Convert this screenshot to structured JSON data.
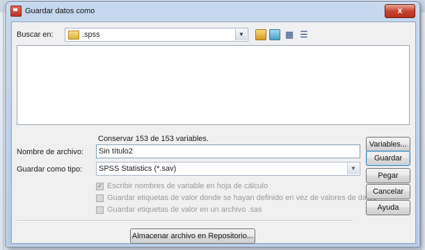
{
  "window": {
    "title": "Guardar datos como",
    "close_label": "x"
  },
  "lookin": {
    "label": "Buscar en:",
    "folder": ".spss"
  },
  "info": {
    "keep_variables": "Conservar 153 de 153 variables."
  },
  "form": {
    "file_name_label": "Nombre de archivo:",
    "file_name_value": "Sin título2",
    "save_type_label": "Guardar como tipo:",
    "save_type_value": "SPSS Statistics (*.sav)"
  },
  "options": [
    {
      "label": "Escribir nombres de variable en hoja de cálculo",
      "checked": true
    },
    {
      "label": "Guardar etiquetas de valor donde se hayan definido en vez de valores de datos",
      "checked": false
    },
    {
      "label": "Guardar etiquetas de valor en un archivo .sas",
      "checked": false
    }
  ],
  "buttons": {
    "variables": "Variables...",
    "save": "Guardar",
    "paste": "Pegar",
    "cancel": "Cancelar",
    "help": "Ayuda",
    "repository": "Almacenar archivo en Repositorio..."
  },
  "icons": {
    "title": "save-data-icon",
    "folder": "folder-icon",
    "up": "up-folder-icon",
    "new_folder": "new-folder-icon",
    "list": "list-view-icon",
    "details": "details-view-icon"
  }
}
